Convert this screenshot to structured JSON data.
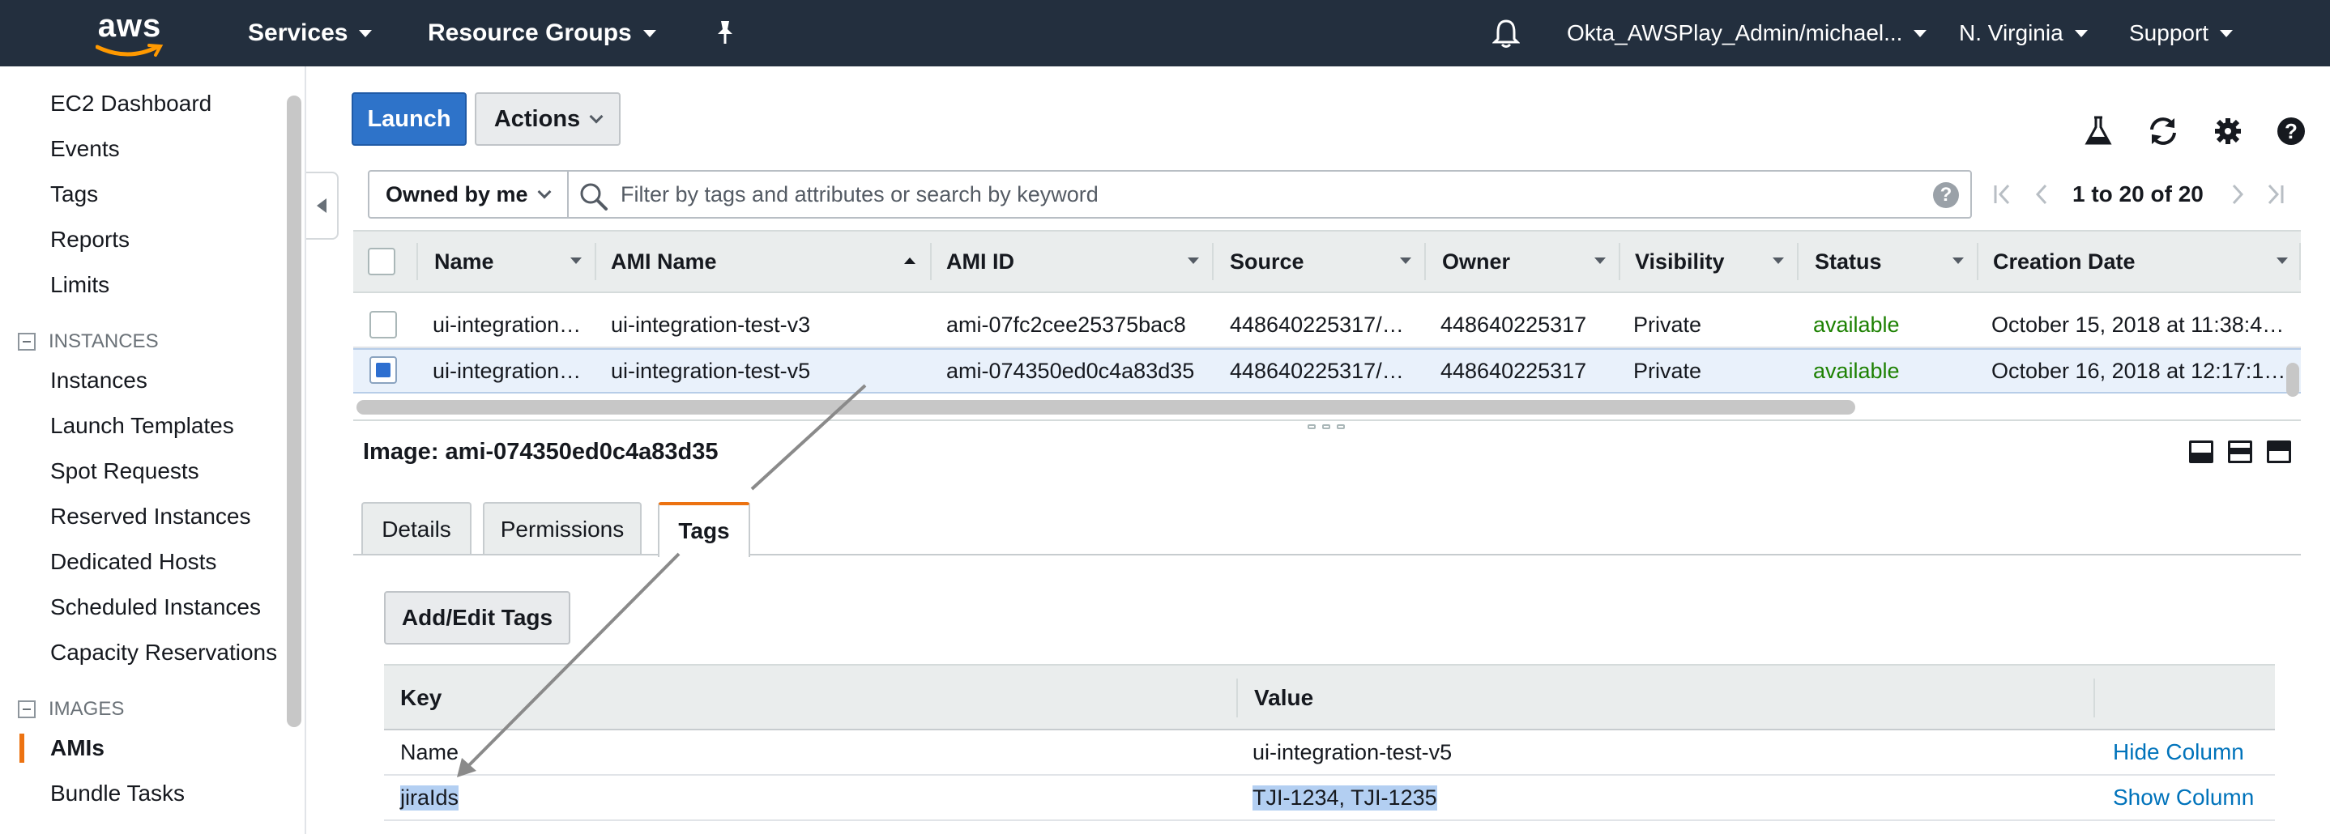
{
  "topnav": {
    "logo_text": "aws",
    "services": "Services",
    "resource_groups": "Resource Groups",
    "account": "Okta_AWSPlay_Admin/michael...",
    "region": "N. Virginia",
    "support": "Support"
  },
  "sidebar": {
    "items": [
      "EC2 Dashboard",
      "Events",
      "Tags",
      "Reports",
      "Limits"
    ],
    "instances_section": "INSTANCES",
    "instances_items": [
      "Instances",
      "Launch Templates",
      "Spot Requests",
      "Reserved Instances",
      "Dedicated Hosts",
      "Scheduled Instances",
      "Capacity Reservations"
    ],
    "images_section": "IMAGES",
    "images_items": [
      "AMIs",
      "Bundle Tasks"
    ],
    "active_item": "AMIs"
  },
  "toolbar": {
    "launch_label": "Launch",
    "actions_label": "Actions"
  },
  "filter": {
    "owned_label": "Owned by me",
    "placeholder": "Filter by tags and attributes or search by keyword",
    "pager_text": "1 to 20 of 20"
  },
  "table": {
    "columns": [
      "Name",
      "AMI Name",
      "AMI ID",
      "Source",
      "Owner",
      "Visibility",
      "Status",
      "Creation Date"
    ],
    "rows": [
      {
        "name": "ui-integration…",
        "ami_name": "ui-integration-test-v3",
        "ami_id": "ami-07fc2cee25375bac8",
        "source": "448640225317/…",
        "owner": "448640225317",
        "visibility": "Private",
        "status": "available",
        "created": "October 15, 2018 at 11:38:4…",
        "selected": false
      },
      {
        "name": "ui-integration…",
        "ami_name": "ui-integration-test-v5",
        "ami_id": "ami-074350ed0c4a83d35",
        "source": "448640225317/…",
        "owner": "448640225317",
        "visibility": "Private",
        "status": "available",
        "created": "October 16, 2018 at 12:17:1…",
        "selected": true
      }
    ]
  },
  "detail": {
    "title": "Image: ami-074350ed0c4a83d35",
    "tabs": [
      "Details",
      "Permissions",
      "Tags"
    ],
    "active_tab": "Tags",
    "add_edit_label": "Add/Edit Tags",
    "tag_columns": [
      "Key",
      "Value"
    ],
    "tags": [
      {
        "key": "Name",
        "value": "ui-integration-test-v5",
        "action": "Hide Column"
      },
      {
        "key": "jiraIds",
        "value": "TJI-1234, TJI-1235",
        "action": "Show Column"
      }
    ]
  },
  "colors": {
    "nav_bg": "#232f3e",
    "primary": "#2e73c9",
    "accent": "#ec7211",
    "available": "#1d8102",
    "link": "#0073bb",
    "selection": "#b3cff2"
  },
  "icons": [
    "bell-icon",
    "pin-icon",
    "flask-icon",
    "refresh-icon",
    "gear-icon",
    "help-icon",
    "search-icon",
    "first-page-icon",
    "prev-page-icon",
    "next-page-icon",
    "last-page-icon"
  ]
}
